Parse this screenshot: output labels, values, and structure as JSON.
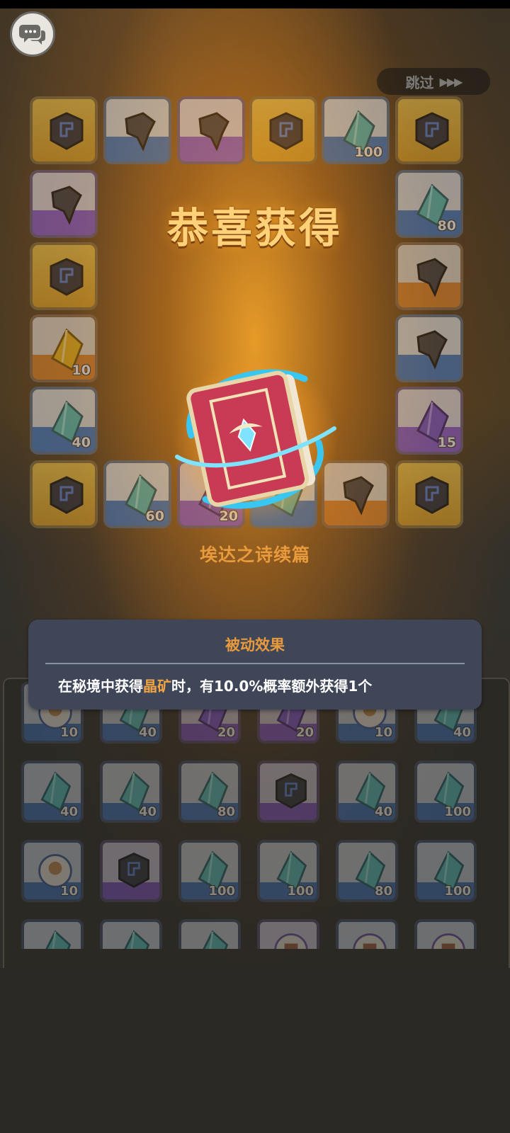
{
  "header": {
    "chat_icon": "chat-bubbles-icon",
    "skip_label": "跳过",
    "skip_arrows": "▶▶▶"
  },
  "reward": {
    "title": "恭喜获得",
    "item_name": "埃达之诗续篇",
    "item_icon": "spell-book-icon"
  },
  "passive": {
    "title": "被动效果",
    "desc_prefix": "在秘境中获得",
    "desc_highlight": "晶矿",
    "desc_suffix": "时，有10.0%概率额外获得1个"
  },
  "ring_tiles": [
    {
      "icon": "cube-core-icon",
      "rarity": "gold",
      "qty": ""
    },
    {
      "icon": "stone-shard-icon",
      "rarity": "blue",
      "qty": ""
    },
    {
      "icon": "stone-shard-icon",
      "rarity": "purple",
      "qty": ""
    },
    {
      "icon": "cube-core-icon",
      "rarity": "gold",
      "qty": ""
    },
    {
      "icon": "crystal-icon",
      "rarity": "blue",
      "qty": "100"
    },
    {
      "icon": "cube-core-icon",
      "rarity": "gold",
      "qty": ""
    },
    {
      "icon": "stone-shard-icon",
      "rarity": "purple",
      "qty": ""
    },
    {
      "icon": "crystal-icon",
      "rarity": "blue",
      "qty": "80"
    },
    {
      "icon": "cube-core-icon",
      "rarity": "gold",
      "qty": ""
    },
    {
      "icon": "stone-shard-icon",
      "rarity": "orange",
      "qty": ""
    },
    {
      "icon": "gold-crystal-icon",
      "rarity": "orange",
      "qty": "10"
    },
    {
      "icon": "stone-shard-icon",
      "rarity": "blue",
      "qty": ""
    },
    {
      "icon": "crystal-icon",
      "rarity": "blue",
      "qty": "40"
    },
    {
      "icon": "purple-crystal-icon",
      "rarity": "purple",
      "qty": "15"
    },
    {
      "icon": "cube-core-icon",
      "rarity": "gold",
      "qty": ""
    },
    {
      "icon": "crystal-icon",
      "rarity": "blue",
      "qty": "60"
    },
    {
      "icon": "purple-crystal-icon",
      "rarity": "purple",
      "qty": "20"
    },
    {
      "icon": "crystal-icon",
      "rarity": "blue",
      "qty": ""
    },
    {
      "icon": "stone-shard-icon",
      "rarity": "orange",
      "qty": ""
    },
    {
      "icon": "cube-core-icon",
      "rarity": "gold",
      "qty": ""
    }
  ],
  "grid_tiles": [
    {
      "icon": "hero-portrait-icon",
      "rarity": "blue",
      "qty": "10"
    },
    {
      "icon": "crystal-icon",
      "rarity": "blue",
      "qty": "40"
    },
    {
      "icon": "purple-crystal-icon",
      "rarity": "purple",
      "qty": "20"
    },
    {
      "icon": "purple-crystal-icon",
      "rarity": "purple",
      "qty": "20"
    },
    {
      "icon": "hero-portrait-icon",
      "rarity": "blue",
      "qty": "10"
    },
    {
      "icon": "crystal-icon",
      "rarity": "blue",
      "qty": "40"
    },
    {
      "icon": "crystal-icon",
      "rarity": "blue",
      "qty": "40"
    },
    {
      "icon": "crystal-icon",
      "rarity": "blue",
      "qty": "40"
    },
    {
      "icon": "crystal-icon",
      "rarity": "blue",
      "qty": "80"
    },
    {
      "icon": "cube-core-icon",
      "rarity": "purple",
      "qty": ""
    },
    {
      "icon": "crystal-icon",
      "rarity": "blue",
      "qty": "40"
    },
    {
      "icon": "crystal-icon",
      "rarity": "blue",
      "qty": "100"
    },
    {
      "icon": "hero-portrait-icon",
      "rarity": "blue",
      "qty": "10"
    },
    {
      "icon": "cube-core-icon",
      "rarity": "purple",
      "qty": ""
    },
    {
      "icon": "crystal-icon",
      "rarity": "blue",
      "qty": "100"
    },
    {
      "icon": "crystal-icon",
      "rarity": "blue",
      "qty": "100"
    },
    {
      "icon": "crystal-icon",
      "rarity": "blue",
      "qty": "80"
    },
    {
      "icon": "crystal-icon",
      "rarity": "blue",
      "qty": "100"
    },
    {
      "icon": "crystal-icon",
      "rarity": "blue",
      "qty": ""
    },
    {
      "icon": "crystal-icon",
      "rarity": "blue",
      "qty": ""
    },
    {
      "icon": "crystal-icon",
      "rarity": "blue",
      "qty": ""
    },
    {
      "icon": "relic-icon",
      "rarity": "purple",
      "qty": ""
    },
    {
      "icon": "relic-icon",
      "rarity": "blue",
      "qty": ""
    },
    {
      "icon": "relic-icon",
      "rarity": "blue",
      "qty": ""
    }
  ]
}
